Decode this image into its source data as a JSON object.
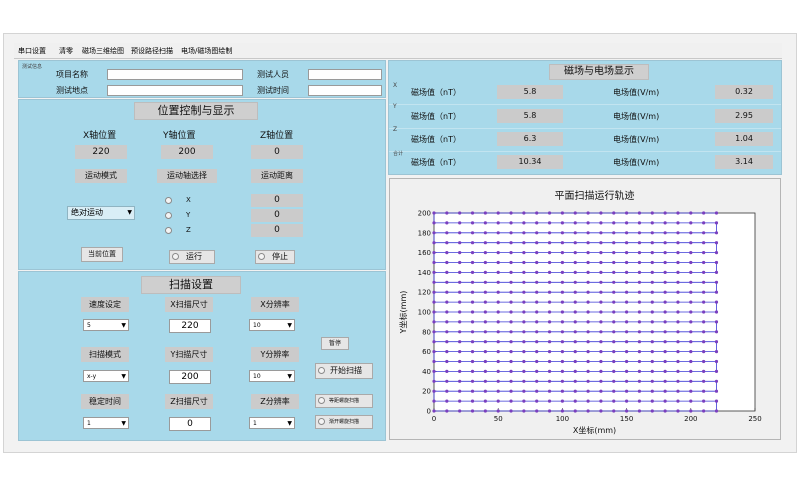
{
  "menu": [
    "串口设置",
    "清零",
    "磁场三维绘图",
    "预设路径扫描",
    "电场/磁场图绘制"
  ],
  "test_info": {
    "group_label": "测试信息",
    "project_name_label": "项目名称",
    "project_name_value": "",
    "tester_label": "测试人员",
    "tester_value": "",
    "site_label": "测试地点",
    "site_value": "",
    "time_label": "测试时间",
    "time_value": ""
  },
  "position": {
    "title": "位置控制与显示",
    "x_label": "X轴位置",
    "x_value": "220",
    "y_label": "Y轴位置",
    "y_value": "200",
    "z_label": "Z轴位置",
    "z_value": "0",
    "mode_label": "运动模式",
    "mode_value": "绝对运动",
    "axis_label": "运动轴选择",
    "axis_options": [
      "X",
      "Y",
      "Z"
    ],
    "distance_label": "运动距离",
    "distances": [
      "0",
      "0",
      "0"
    ],
    "current_button": "当前位置",
    "run_label": "运行",
    "stop_label": "停止"
  },
  "scan": {
    "title": "扫描设置",
    "speed_label": "速度设定",
    "speed_value": "5",
    "x_size_label": "X扫描尺寸",
    "x_size_value": "220",
    "x_res_label": "X分辨率",
    "x_res_value": "10",
    "mode_label": "扫描模式",
    "mode_value": "x-y",
    "y_size_label": "Y扫描尺寸",
    "y_size_value": "200",
    "y_res_label": "Y分辨率",
    "y_res_value": "10",
    "settle_label": "稳定时间",
    "settle_value": "1",
    "z_size_label": "Z扫描尺寸",
    "z_size_value": "0",
    "z_res_label": "Z分辨率",
    "z_res_value": "1",
    "pause_button": "暂停",
    "start_label": "开始扫描",
    "spiral_in_label": "等距螺旋扫描",
    "spiral_out_label": "渐开螺旋扫描"
  },
  "field": {
    "title": "磁场与电场显示",
    "mag_label": "磁场值（nT）",
    "elec_label": "电场值(V/m)",
    "rows": [
      {
        "axis": "X",
        "mag": "5.8",
        "elec": "0.32"
      },
      {
        "axis": "Y",
        "mag": "5.8",
        "elec": "2.95"
      },
      {
        "axis": "Z",
        "mag": "6.3",
        "elec": "1.04"
      },
      {
        "axis": "合计",
        "mag": "10.34",
        "elec": "3.14"
      }
    ]
  },
  "chart_data": {
    "type": "scatter",
    "title": "平面扫描运行轨迹",
    "xlabel": "X坐标(mm)",
    "ylabel": "Y坐标(mm)",
    "xlim": [
      0,
      250
    ],
    "ylim": [
      0,
      200
    ],
    "x_ticks": [
      0,
      50,
      100,
      150,
      200,
      250
    ],
    "y_ticks": [
      0,
      20,
      40,
      60,
      80,
      100,
      120,
      140,
      160,
      180,
      200
    ],
    "x_step": 10,
    "y_step": 10,
    "x_max": 220,
    "y_max": 200,
    "point_color": "#7a3fbf",
    "line_color": "#3b3bd6"
  }
}
